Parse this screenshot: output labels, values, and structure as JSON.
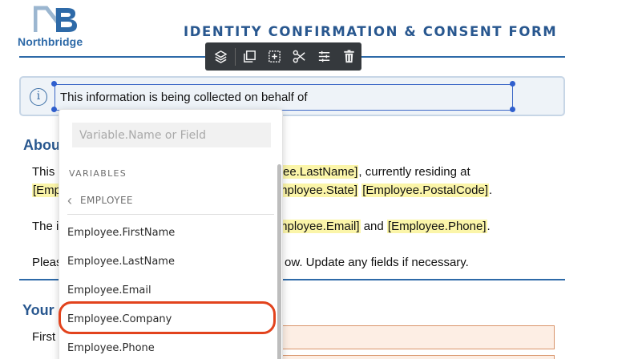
{
  "brand": {
    "name": "Northbridge",
    "colors": {
      "primary": "#2e6aa8",
      "logo_light": "#9bb6d0",
      "highlight_ring": "#e2431d",
      "variable_tag": "#fbf5a9"
    }
  },
  "document": {
    "title": "IDENTITY CONFIRMATION & CONSENT FORM"
  },
  "toolbar": {
    "buttons": [
      {
        "name": "layers-icon"
      },
      {
        "name": "duplicate-icon"
      },
      {
        "name": "add-block-icon"
      },
      {
        "name": "cut-icon"
      },
      {
        "name": "settings-sliders-icon"
      },
      {
        "name": "delete-icon"
      }
    ]
  },
  "info_box": {
    "icon": "info-icon",
    "icon_glyph": "i",
    "text": "This information is being collected on behalf of"
  },
  "about": {
    "heading": "Abou",
    "line1_start": "This ",
    "line1_tag": "ee.LastName]",
    "line1_end": ", currently residing at",
    "line2_tag_start": "[Emp",
    "line2_tag1": "mployee.State]",
    "line2_tag2": "[Employee.PostalCode]",
    "line2_end": ".",
    "line3_start": "The i",
    "line3_tag1": "mployee.Email]",
    "line3_mid": " and ",
    "line3_tag2": "[Employee.Phone]",
    "line3_end": ".",
    "line4_start": "Pleas",
    "line4_end": "ow. Update any fields if necessary."
  },
  "your_section": {
    "heading": "Your",
    "field_label": "First"
  },
  "variable_picker": {
    "search_placeholder": "Variable.Name or Field",
    "group_label": "VARIABLES",
    "back_label": "EMPLOYEE",
    "back_icon": "chevron-left-icon",
    "items": [
      "Employee.FirstName",
      "Employee.LastName",
      "Employee.Email",
      "Employee.Company",
      "Employee.Phone"
    ],
    "highlighted_item": "Employee.Company"
  }
}
